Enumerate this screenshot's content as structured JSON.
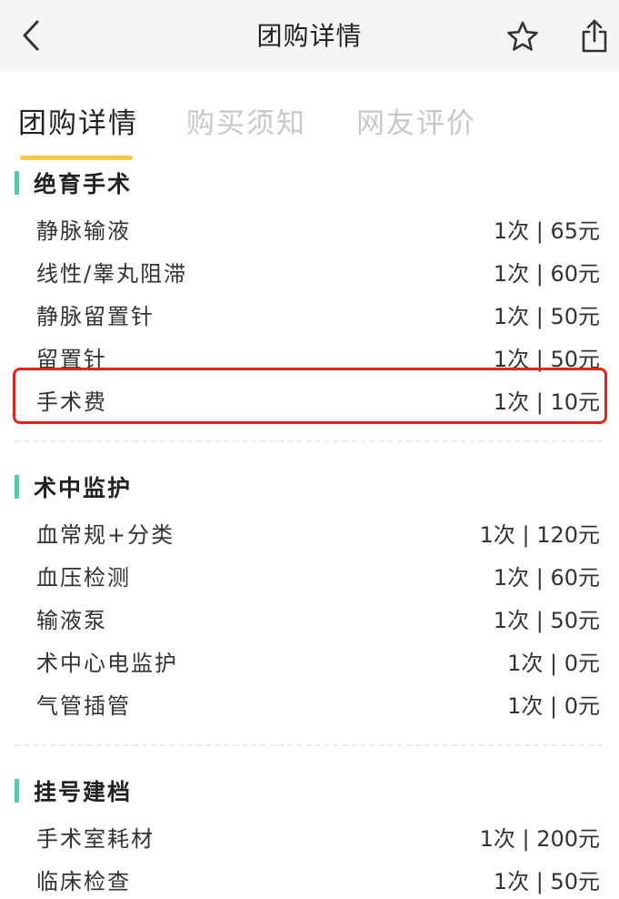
{
  "nav": {
    "title": "团购详情"
  },
  "tabs": [
    {
      "label": "团购详情",
      "active": true
    },
    {
      "label": "购买须知",
      "active": false
    },
    {
      "label": "网友评价",
      "active": false
    }
  ],
  "sections": [
    {
      "title": "绝育手术",
      "items": [
        {
          "name": "静脉输液",
          "price": "1次 | 65元"
        },
        {
          "name": "线性/睾丸阻滞",
          "price": "1次 | 60元"
        },
        {
          "name": "静脉留置针",
          "price": "1次 | 50元"
        },
        {
          "name": "留置针",
          "price": "1次 | 50元"
        },
        {
          "name": "手术费",
          "price": "1次 | 10元",
          "highlighted": true
        }
      ]
    },
    {
      "title": "术中监护",
      "items": [
        {
          "name": "血常规+分类",
          "price": "1次 | 120元"
        },
        {
          "name": "血压检测",
          "price": "1次 | 60元"
        },
        {
          "name": "输液泵",
          "price": "1次 | 50元"
        },
        {
          "name": "术中心电监护",
          "price": "1次 | 0元"
        },
        {
          "name": "气管插管",
          "price": "1次 | 0元"
        }
      ]
    },
    {
      "title": "挂号建档",
      "items": [
        {
          "name": "手术室耗材",
          "price": "1次 | 200元"
        },
        {
          "name": "临床检查",
          "price": "1次 | 50元"
        }
      ]
    }
  ],
  "icons": {
    "back": "chevron-left-icon",
    "favorite": "star-outline-icon",
    "share": "share-icon"
  },
  "colors": {
    "section_accent": "#5cc5b0",
    "tab_underline": "#f6c843",
    "highlight_border": "#e3261d",
    "inactive_tab": "#c8c8c8"
  }
}
